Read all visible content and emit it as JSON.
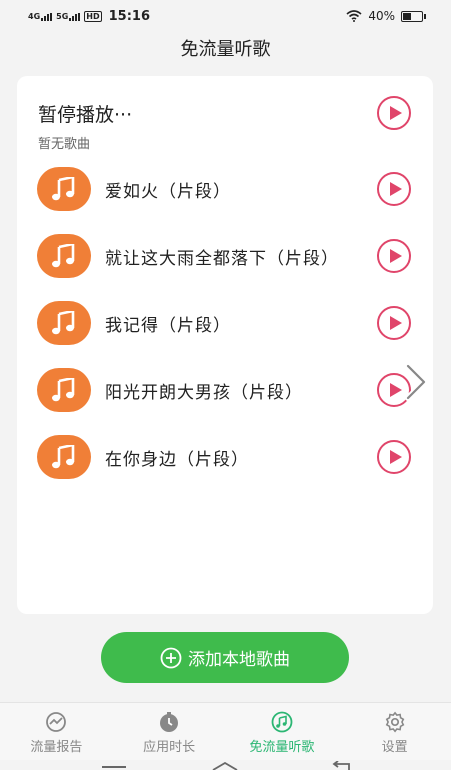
{
  "status_bar": {
    "network_1": "4G",
    "network_2": "5G",
    "hd_badge": "HD",
    "time": "15:16",
    "battery": "40%"
  },
  "page": {
    "title": "免流量听歌"
  },
  "now_playing": {
    "title": "暂停播放···",
    "subtitle": "暂无歌曲"
  },
  "songs": [
    {
      "name": "爱如火（片段）"
    },
    {
      "name": "就让这大雨全都落下（片段）"
    },
    {
      "name": "我记得（片段）"
    },
    {
      "name": "阳光开朗大男孩（片段）"
    },
    {
      "name": "在你身边（片段）"
    }
  ],
  "add_button": {
    "label": "添加本地歌曲"
  },
  "tabs": [
    {
      "label": "流量报告",
      "icon": "traffic-report-icon"
    },
    {
      "label": "应用时长",
      "icon": "app-time-icon"
    },
    {
      "label": "免流量听歌",
      "icon": "music-icon",
      "active": true
    },
    {
      "label": "设置",
      "icon": "gear-icon"
    }
  ],
  "colors": {
    "accent_green": "#3fbb4c",
    "tab_active": "#2bb673",
    "note_orange": "#f07f37",
    "play_red": "#e0456a"
  }
}
